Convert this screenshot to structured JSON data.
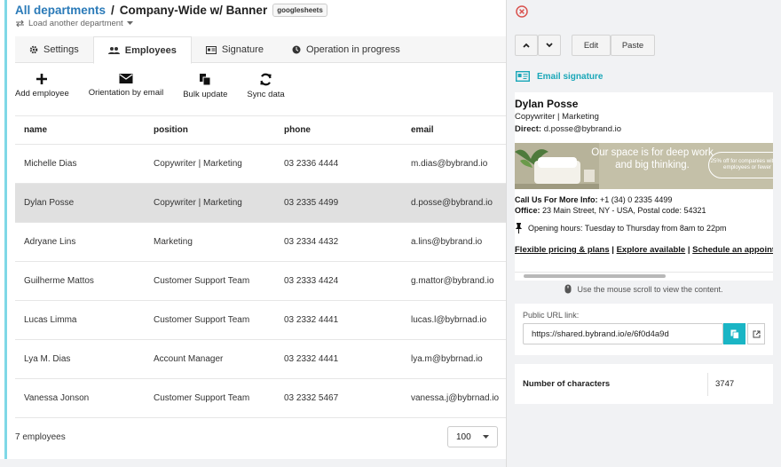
{
  "header": {
    "breadcrumb": "All departments",
    "separator": "/",
    "title": "Company-Wide w/ Banner",
    "badge": "googlesheets",
    "subtitle": "Load another department"
  },
  "tabs": [
    {
      "label": "Settings",
      "icon": "gear-icon"
    },
    {
      "label": "Employees",
      "icon": "users-icon",
      "active": true
    },
    {
      "label": "Signature",
      "icon": "id-card-icon"
    },
    {
      "label": "Operation in progress",
      "icon": "clock-icon"
    }
  ],
  "toolbar": {
    "add": "Add employee",
    "orientation": "Orientation by email",
    "bulk": "Bulk update",
    "sync": "Sync data"
  },
  "table": {
    "columns": [
      "name",
      "position",
      "phone",
      "email"
    ],
    "rows": [
      [
        "Michelle Dias",
        "Copywriter | Marketing",
        "03 2336 4444",
        "m.dias@bybrand.io"
      ],
      [
        "Dylan Posse",
        "Copywriter | Marketing",
        "03 2335 4499",
        "d.posse@bybrand.io"
      ],
      [
        "Adryane Lins",
        "Marketing",
        "03 2334 4432",
        "a.lins@bybrand.io"
      ],
      [
        "Guilherme Mattos",
        "Customer Support Team",
        "03 2333 4424",
        "g.mattor@bybrand.io"
      ],
      [
        "Lucas Limma",
        "Customer Support Team",
        "03 2332 4441",
        "lucas.l@bybrnad.io"
      ],
      [
        "Lya M. Dias",
        "Account Manager",
        "03 2332 4441",
        "lya.m@bybrnad.io"
      ],
      [
        "Vanessa Jonson",
        "Customer Support Team",
        "03 2332 5467",
        "vanessa.j@bybrnad.io"
      ]
    ],
    "selected_row": 1
  },
  "footer": {
    "count": "7 employees",
    "page_size": "100"
  },
  "panel": {
    "edit": "Edit",
    "paste": "Paste",
    "sig_title": "Email signature",
    "signature": {
      "name": "Dylan Posse",
      "role": "Copywriter | Marketing",
      "direct_label": "Direct:",
      "direct_value": "d.posse@bybrand.io",
      "banner_text": "Our space is for deep work and big thinking.",
      "banner_offer": "25% off for companies with 20 employees or fewer",
      "info_label": "Call Us For More Info:",
      "info_value": "+1 (34) 0 2335 4499",
      "office_label": "Office:",
      "office_value": "23 Main Street, NY - USA, Postal code: 54321",
      "hours": "Opening hours: Tuesday to Thursday from 8am to 22pm",
      "link1": "Flexible pricing & plans",
      "link2": "Explore available",
      "link3": "Schedule an appointment",
      "link_sep": "|"
    },
    "scroll_hint": "Use the mouse scroll to view the content.",
    "url_label": "Public URL link:",
    "url_value": "https://shared.bybrand.io/e/6f0d4a9d",
    "chars_label": "Number of characters",
    "chars_value": "3747"
  },
  "colors": {
    "accent": "#1ab5c5",
    "link": "#2a7ab8",
    "close": "#d9534f"
  }
}
